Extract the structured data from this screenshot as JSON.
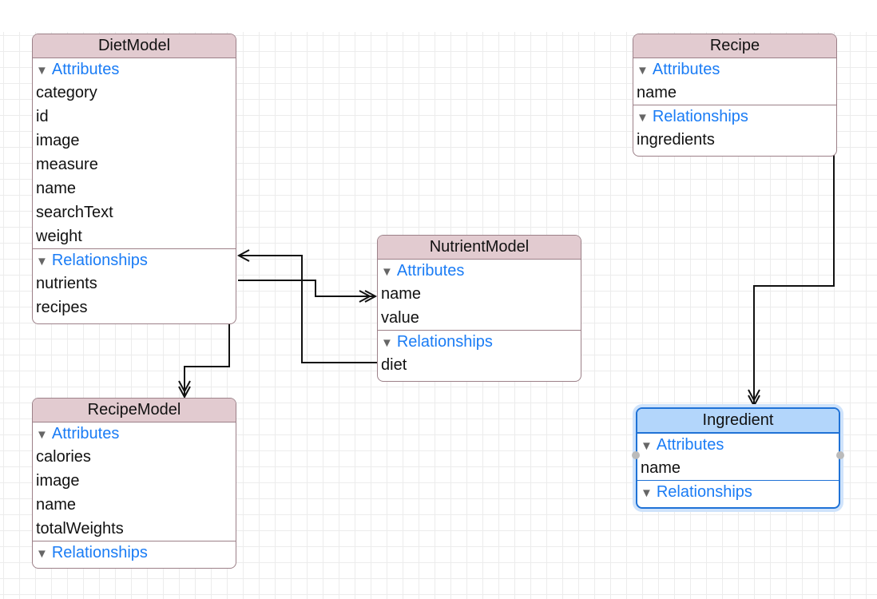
{
  "entities": {
    "diet": {
      "title": "DietModel",
      "attributes_label": "Attributes",
      "attributes": [
        "category",
        "id",
        "image",
        "measure",
        "name",
        "searchText",
        "weight"
      ],
      "relationships_label": "Relationships",
      "relationships": [
        "nutrients",
        "recipes"
      ]
    },
    "recipe_model": {
      "title": "RecipeModel",
      "attributes_label": "Attributes",
      "attributes": [
        "calories",
        "image",
        "name",
        "totalWeights"
      ],
      "relationships_label": "Relationships",
      "relationships": []
    },
    "nutrient": {
      "title": "NutrientModel",
      "attributes_label": "Attributes",
      "attributes": [
        "name",
        "value"
      ],
      "relationships_label": "Relationships",
      "relationships": [
        "diet"
      ]
    },
    "recipe": {
      "title": "Recipe",
      "attributes_label": "Attributes",
      "attributes": [
        "name"
      ],
      "relationships_label": "Relationships",
      "relationships": [
        "ingredients"
      ]
    },
    "ingredient": {
      "title": "Ingredient",
      "selected": true,
      "attributes_label": "Attributes",
      "attributes": [
        "name"
      ],
      "relationships_label": "Relationships",
      "relationships": []
    }
  },
  "colors": {
    "header": "#e2cbd0",
    "selected_header": "#b3d6fb",
    "section_label": "#1a7cf5",
    "border": "#9c8088",
    "selected_border": "#1f72d6"
  }
}
